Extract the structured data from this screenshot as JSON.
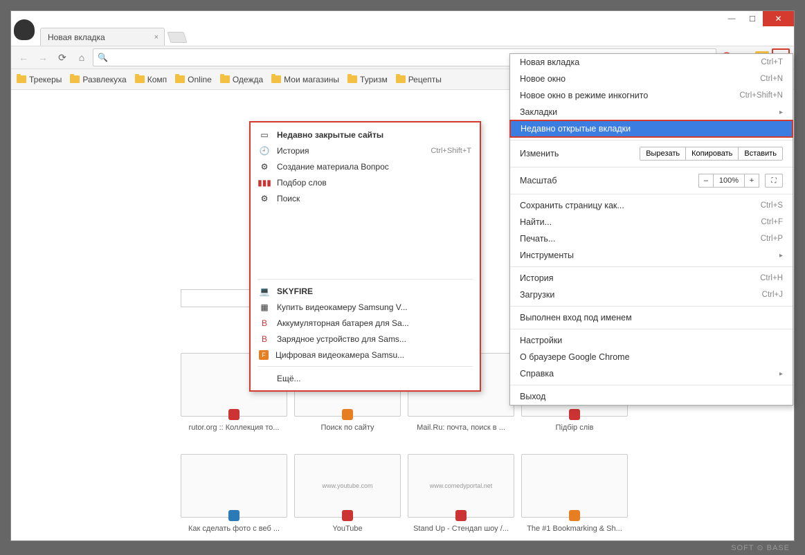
{
  "window": {
    "tab_title": "Новая вкладка",
    "minimize": "—",
    "maximize": "☐",
    "close": "✕"
  },
  "bookmarks": [
    "Трекеры",
    "Развлекуха",
    "Комп",
    "Online",
    "Одежда",
    "Мои магазины",
    "Туризм",
    "Рецепты"
  ],
  "menu": {
    "new_tab": {
      "label": "Новая вкладка",
      "shortcut": "Ctrl+T"
    },
    "new_window": {
      "label": "Новое окно",
      "shortcut": "Ctrl+N"
    },
    "incognito": {
      "label": "Новое окно в режиме инкогнито",
      "shortcut": "Ctrl+Shift+N"
    },
    "bookmarks": {
      "label": "Закладки"
    },
    "recent_tabs": {
      "label": "Недавно открытые вкладки"
    },
    "edit": {
      "label": "Изменить",
      "cut": "Вырезать",
      "copy": "Копировать",
      "paste": "Вставить"
    },
    "zoom": {
      "label": "Масштаб",
      "value": "100%",
      "minus": "–",
      "plus": "+"
    },
    "save_as": {
      "label": "Сохранить страницу как...",
      "shortcut": "Ctrl+S"
    },
    "find": {
      "label": "Найти...",
      "shortcut": "Ctrl+F"
    },
    "print": {
      "label": "Печать...",
      "shortcut": "Ctrl+P"
    },
    "tools": {
      "label": "Инструменты"
    },
    "history": {
      "label": "История",
      "shortcut": "Ctrl+H"
    },
    "downloads": {
      "label": "Загрузки",
      "shortcut": "Ctrl+J"
    },
    "signed_in": {
      "label": "Выполнен вход под именем"
    },
    "settings": {
      "label": "Настройки"
    },
    "about": {
      "label": "О браузере Google Chrome"
    },
    "help": {
      "label": "Справка"
    },
    "exit": {
      "label": "Выход"
    }
  },
  "submenu": {
    "header": "Недавно закрытые сайты",
    "history": {
      "label": "История",
      "shortcut": "Ctrl+Shift+T"
    },
    "items1": [
      "Создание материала Вопрос",
      "Подбор слов",
      "Поиск"
    ],
    "device": "SKYFIRE",
    "items2": [
      "Купить видеокамеру Samsung V...",
      "Аккумуляторная батарея для Sa...",
      "Зарядное устройство для Sams...",
      "Цифровая видеокамера Samsu..."
    ],
    "more": "Ещё..."
  },
  "tiles": [
    {
      "caption": "rutor.org :: Коллекция то...",
      "badge_color": "#c33",
      "thumb_text": ""
    },
    {
      "caption": "Поиск по сайту",
      "badge_color": "#e67e22",
      "thumb_text": ""
    },
    {
      "caption": "Mail.Ru: почта, поиск в ...",
      "badge_color": "",
      "thumb_text": ""
    },
    {
      "caption": "Підбір слів",
      "badge_color": "#c33",
      "thumb_text": ""
    },
    {
      "caption": "Как сделать фото с веб ...",
      "badge_color": "#2a7ab8",
      "thumb_text": ""
    },
    {
      "caption": "YouTube",
      "badge_color": "#c33",
      "thumb_text": "www.youtube.com"
    },
    {
      "caption": "Stand Up - Стендап шоу /...",
      "badge_color": "#c33",
      "thumb_text": "www.comedyportal.net"
    },
    {
      "caption": "The #1 Bookmarking & Sh...",
      "badge_color": "#e67e22",
      "thumb_text": ""
    }
  ],
  "watermark": "SOFT ⊙ BASE"
}
